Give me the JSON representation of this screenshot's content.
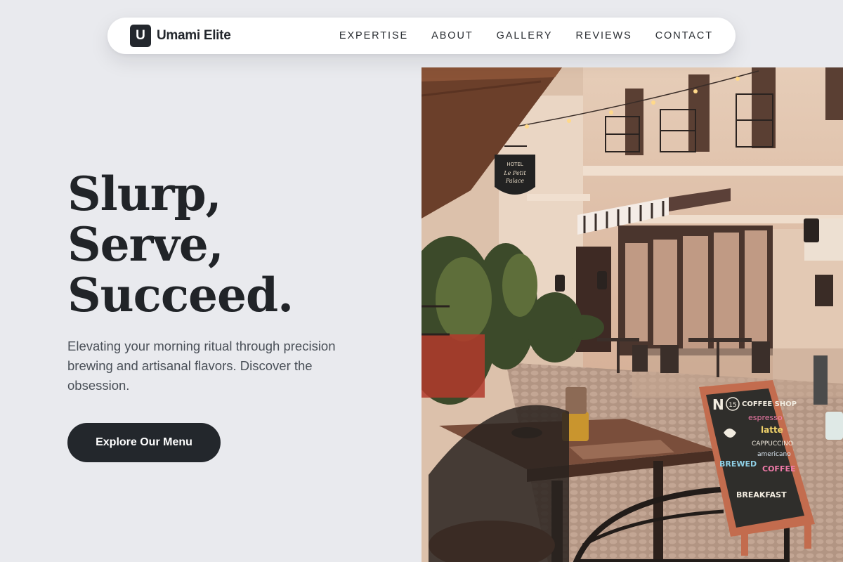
{
  "brand": {
    "logo_letter": "U",
    "name": "Umami Elite"
  },
  "nav": {
    "links": [
      "EXPERTISE",
      "ABOUT",
      "GALLERY",
      "REVIEWS",
      "CONTACT"
    ]
  },
  "hero": {
    "headline": [
      "Slurp,",
      "Serve,",
      "Succeed."
    ],
    "subtext": "Elevating your morning ritual through precision brewing and artisanal flavors. Discover the obsession.",
    "cta_label": "Explore Our Menu"
  },
  "photo": {
    "hanging_sign": [
      "HOTEL",
      "Le Petit",
      "Palace"
    ],
    "chalkboard": [
      "N",
      "15",
      "COFFEE SHOP",
      "espresso",
      "latte",
      "CAPPUCCINO",
      "americano",
      "BREWED",
      "COFFEE",
      "BREAKFAST"
    ]
  },
  "colors": {
    "background": "#e9eaee",
    "dark": "#23272c",
    "nav_bg": "#ffffff",
    "text_muted": "#4a5058"
  }
}
